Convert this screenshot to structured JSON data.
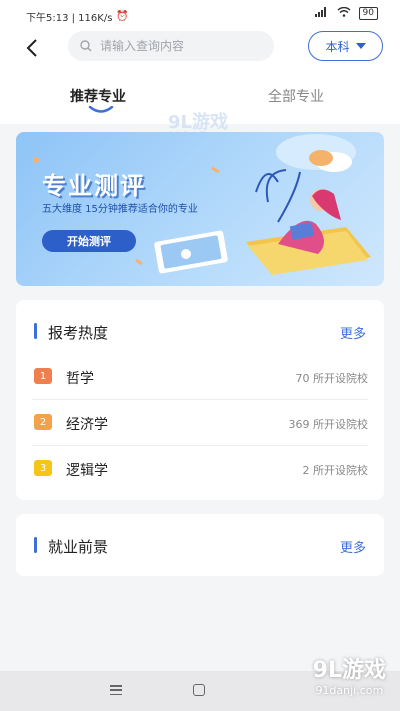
{
  "status_bar": {
    "time_speed": "下午5:13 | 116K/s",
    "battery": "90"
  },
  "header": {
    "search_placeholder": "请输入查询内容",
    "level_label": "本科"
  },
  "tabs": [
    {
      "label": "推荐专业",
      "active": true
    },
    {
      "label": "全部专业",
      "active": false
    }
  ],
  "banner": {
    "title": "专业测评",
    "subtitle": "五大维度 15分钟推荐适合你的专业",
    "button": "开始测评"
  },
  "hot_card": {
    "title": "报考热度",
    "more": "更多",
    "items": [
      {
        "rank": "1",
        "name": "哲学",
        "count": "70 所开设院校",
        "color": "#f07f4f"
      },
      {
        "rank": "2",
        "name": "经济学",
        "count": "369 所开设院校",
        "color": "#f5a04a"
      },
      {
        "rank": "3",
        "name": "逻辑学",
        "count": "2 所开设院校",
        "color": "#f5c518"
      }
    ]
  },
  "job_card": {
    "title": "就业前景",
    "more": "更多"
  },
  "watermark": {
    "logo": "9L游戏",
    "site": "91danji.com"
  },
  "colors": {
    "accent": "#3d6fd9",
    "background": "#f4f5f7"
  }
}
